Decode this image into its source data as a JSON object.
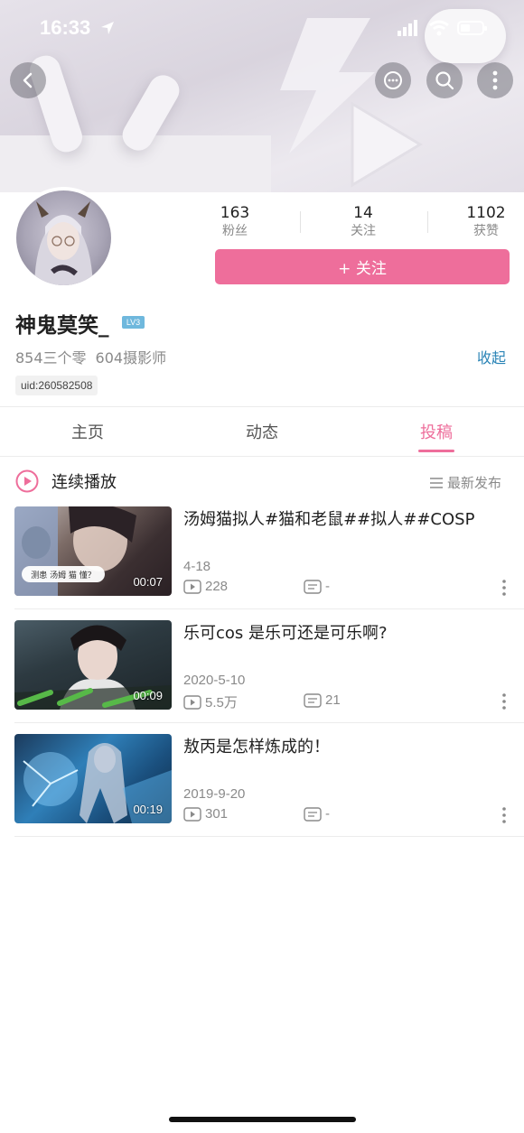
{
  "status_bar": {
    "time": "16:33"
  },
  "profile": {
    "stats": [
      {
        "value": "163",
        "label": "粉丝"
      },
      {
        "value": "14",
        "label": "关注"
      },
      {
        "value": "1102",
        "label": "获赞"
      }
    ],
    "follow_label": "+ 关注",
    "username": "神鬼莫笑_",
    "level": "LV3",
    "titles": [
      "854三个零",
      "604摄影师"
    ],
    "collapse_label": "收起",
    "uid": "uid:260582508"
  },
  "tabs": [
    {
      "label": "主页",
      "active": false
    },
    {
      "label": "动态",
      "active": false
    },
    {
      "label": "投稿",
      "active": true
    }
  ],
  "list_header": {
    "autoplay_label": "连续播放",
    "sort_label": "最新发布"
  },
  "videos": [
    {
      "title": "汤姆猫拟人#猫和老鼠##拟人##COSP",
      "date": "4-18",
      "plays": "228",
      "comments": "-",
      "duration": "00:07",
      "thumb_caption": "测患 汤姆 猫 懂？"
    },
    {
      "title": "乐可cos  是乐可还是可乐啊?",
      "date": "2020-5-10",
      "plays": "5.5万",
      "comments": "21",
      "duration": "00:09"
    },
    {
      "title": "敖丙是怎样炼成的！",
      "date": "2019-9-20",
      "plays": "301",
      "comments": "-",
      "duration": "00:19"
    }
  ],
  "colors": {
    "accent": "#ee6e9b",
    "link": "#2a84b6"
  },
  "icons": [
    "back-icon",
    "message-icon",
    "search-icon",
    "more-icon",
    "play-circle-icon",
    "sort-icon",
    "play-count-icon",
    "comment-icon",
    "dots-vertical-icon"
  ]
}
